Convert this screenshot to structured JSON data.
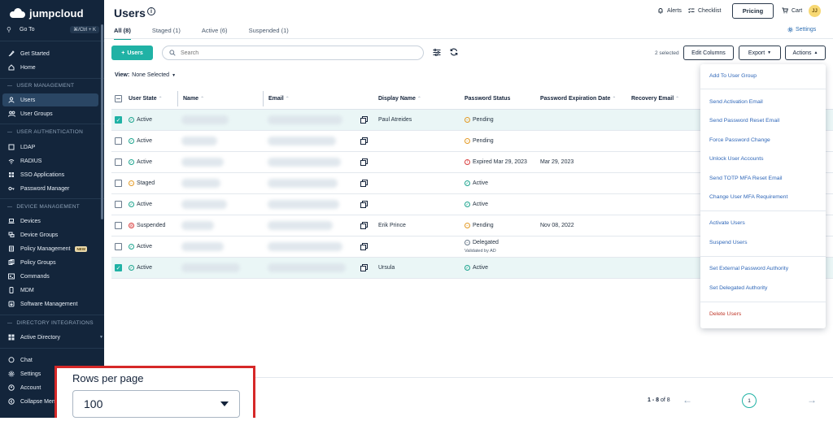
{
  "brand": {
    "name": "jumpcloud"
  },
  "sidebar": {
    "goto": {
      "label": "Go To",
      "shortcut": "⌘/Ctrl + K"
    },
    "top_items": [
      {
        "label": "Get Started",
        "icon": "rocket-icon"
      },
      {
        "label": "Home",
        "icon": "home-icon"
      }
    ],
    "sections": [
      {
        "title": "USER MANAGEMENT",
        "items": [
          {
            "label": "Users",
            "icon": "user-icon",
            "active": true
          },
          {
            "label": "User Groups",
            "icon": "users-icon"
          }
        ]
      },
      {
        "title": "USER AUTHENTICATION",
        "items": [
          {
            "label": "LDAP"
          },
          {
            "label": "RADIUS"
          },
          {
            "label": "SSO Applications"
          },
          {
            "label": "Password Manager"
          }
        ]
      },
      {
        "title": "DEVICE MANAGEMENT",
        "items": [
          {
            "label": "Devices"
          },
          {
            "label": "Device Groups"
          },
          {
            "label": "Policy Management",
            "badge": "NEW"
          },
          {
            "label": "Policy Groups"
          },
          {
            "label": "Commands"
          },
          {
            "label": "MDM"
          },
          {
            "label": "Software Management"
          }
        ]
      },
      {
        "title": "DIRECTORY INTEGRATIONS",
        "items": [
          {
            "label": "Active Directory"
          }
        ]
      }
    ],
    "bottom_items": [
      {
        "label": "Chat"
      },
      {
        "label": "Settings"
      },
      {
        "label": "Account"
      },
      {
        "label": "Collapse Menu"
      }
    ]
  },
  "header": {
    "title": "Users",
    "alerts": "Alerts",
    "checklist": "Checklist",
    "pricing": "Pricing",
    "cart": "Cart",
    "avatar_initials": "JJ"
  },
  "tabs": [
    {
      "label": "All (8)",
      "active": true
    },
    {
      "label": "Staged (1)"
    },
    {
      "label": "Active (6)"
    },
    {
      "label": "Suspended (1)"
    }
  ],
  "settings_link": "Settings",
  "toolbar": {
    "add_label": "Users",
    "search_placeholder": "Search",
    "selected_count": "2 selected",
    "edit_columns": "Edit Columns",
    "export": "Export",
    "actions": "Actions"
  },
  "view": {
    "label": "View:",
    "value": "None Selected"
  },
  "table": {
    "columns": [
      "User State",
      "Name",
      "Email",
      "Display Name",
      "Password Status",
      "Password Expiration Date",
      "Recovery Email"
    ],
    "rows": [
      {
        "selected": true,
        "state": "Active",
        "state_kind": "active",
        "display_name": "Paul Atreides",
        "pw_status": "Pending",
        "pw_kind": "pending",
        "pw_exp": ""
      },
      {
        "selected": false,
        "state": "Active",
        "state_kind": "active",
        "display_name": "",
        "pw_status": "Pending",
        "pw_kind": "pending",
        "pw_exp": ""
      },
      {
        "selected": false,
        "state": "Active",
        "state_kind": "active",
        "display_name": "",
        "pw_status": "Expired Mar 29, 2023",
        "pw_kind": "expired",
        "pw_exp": "Mar 29, 2023"
      },
      {
        "selected": false,
        "state": "Staged",
        "state_kind": "staged",
        "display_name": "",
        "pw_status": "Active",
        "pw_kind": "active",
        "pw_exp": ""
      },
      {
        "selected": false,
        "state": "Active",
        "state_kind": "active",
        "display_name": "",
        "pw_status": "Active",
        "pw_kind": "active",
        "pw_exp": ""
      },
      {
        "selected": false,
        "state": "Suspended",
        "state_kind": "suspended",
        "display_name": "Erik Prince",
        "pw_status": "Pending",
        "pw_kind": "pending",
        "pw_exp": "Nov 08, 2022"
      },
      {
        "selected": false,
        "state": "Active",
        "state_kind": "active",
        "display_name": "",
        "pw_status": "Delegated",
        "pw_kind": "delegated",
        "pw_note": "Validated by AD",
        "pw_exp": ""
      },
      {
        "selected": true,
        "state": "Active",
        "state_kind": "active",
        "display_name": "Ursula",
        "pw_status": "Active",
        "pw_kind": "active",
        "pw_exp": ""
      }
    ]
  },
  "actions_menu": [
    {
      "group": 1,
      "items": [
        "Add To User Group"
      ]
    },
    {
      "group": 2,
      "items": [
        "Send Activation Email",
        "Send Password Reset Email",
        "Force Password Change",
        "Unlock User Accounts",
        "Send TOTP MFA Reset Email",
        "Change User MFA Requirement"
      ]
    },
    {
      "group": 3,
      "items": [
        "Activate Users",
        "Suspend Users"
      ]
    },
    {
      "group": 4,
      "items": [
        "Set External Password Authority",
        "Set Delegated Authority"
      ]
    },
    {
      "group": 5,
      "items": [
        "Delete Users"
      ]
    }
  ],
  "pager": {
    "range": "1 - 8",
    "of": "of 8",
    "page": "1"
  },
  "rows_per_page": {
    "label": "Rows per page",
    "value": "100"
  },
  "colors": {
    "sidebar": "#13253b",
    "accent": "#20b2a5",
    "link": "#2e66b8",
    "danger": "#c0392b",
    "highlight": "#d62828"
  }
}
